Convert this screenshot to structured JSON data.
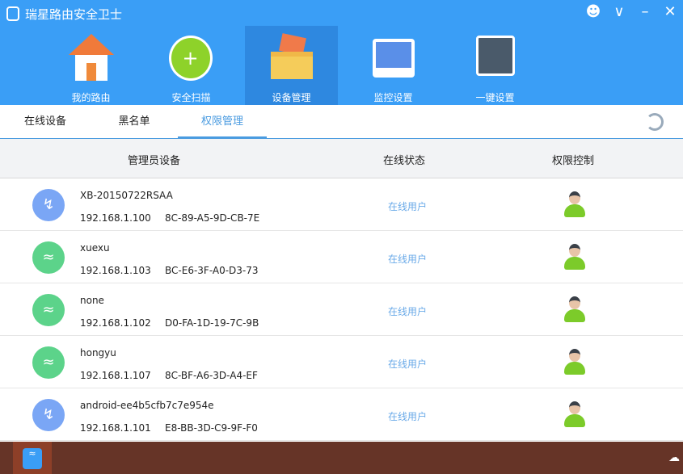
{
  "app": {
    "title": "瑞星路由安全卫士"
  },
  "window_controls": [
    "user-icon",
    "chevron-down-icon",
    "minimize-icon",
    "close-icon"
  ],
  "nav": [
    {
      "label": "我的路由",
      "icon": "house-icon"
    },
    {
      "label": "安全扫描",
      "icon": "shield-icon"
    },
    {
      "label": "设备管理",
      "icon": "box-icon",
      "active": true
    },
    {
      "label": "监控设置",
      "icon": "monitor-icon"
    },
    {
      "label": "一键设置",
      "icon": "router-icon"
    }
  ],
  "tabs": [
    {
      "label": "在线设备"
    },
    {
      "label": "黑名单"
    },
    {
      "label": "权限管理",
      "active": true
    }
  ],
  "table": {
    "headers": [
      "管理员设备",
      "在线状态",
      "权限控制"
    ],
    "rows": [
      {
        "name": "XB-20150722RSAA",
        "ip": "192.168.1.100",
        "mac": "8C-89-A5-9D-CB-7E",
        "status": "在线用户",
        "type": "wired"
      },
      {
        "name": "xuexu",
        "ip": "192.168.1.103",
        "mac": "BC-E6-3F-A0-D3-73",
        "status": "在线用户",
        "type": "wifi"
      },
      {
        "name": "none",
        "ip": "192.168.1.102",
        "mac": "D0-FA-1D-19-7C-9B",
        "status": "在线用户",
        "type": "wifi"
      },
      {
        "name": "hongyu",
        "ip": "192.168.1.107",
        "mac": "8C-BF-A6-3D-A4-EF",
        "status": "在线用户",
        "type": "wifi"
      },
      {
        "name": "android-ee4b5cfb7c7e954e",
        "ip": "192.168.1.101",
        "mac": "E8-BB-3D-C9-9F-F0",
        "status": "在线用户",
        "type": "wired"
      }
    ]
  },
  "colors": {
    "header": "#3a9ef6",
    "wired": "#7aa6f5",
    "wifi": "#5cd38a",
    "taskbar": "#663427"
  }
}
